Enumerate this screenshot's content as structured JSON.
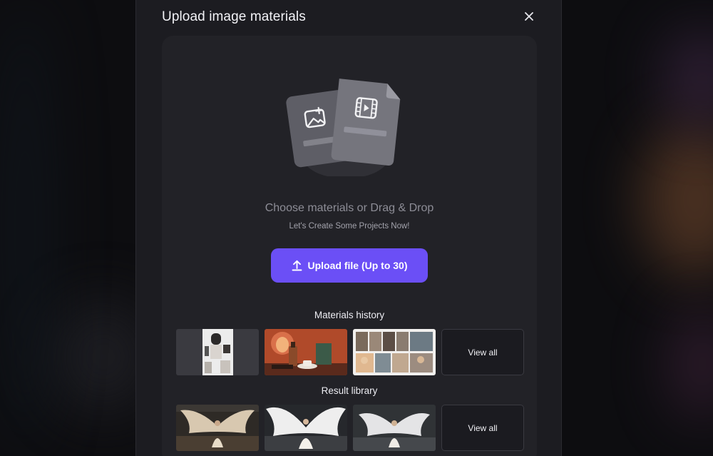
{
  "dialog": {
    "title": "Upload image materials",
    "close_icon": "close-icon"
  },
  "drop_zone": {
    "headline": "Choose materials or Drag & Drop",
    "subtext": "Let's Create Some Projects Now!",
    "upload_button_label": "Upload file (Up to 30)",
    "upload_icon": "upload-icon",
    "illustration_icons": [
      "image-file-icon",
      "video-file-icon"
    ]
  },
  "materials_history": {
    "label": "Materials history",
    "items": [
      "product-collage-thumbnail",
      "perfume-still-life-thumbnail",
      "portrait-grid-thumbnail"
    ],
    "view_all_label": "View all"
  },
  "result_library": {
    "label": "Result library",
    "items": [
      "angel-wings-result-1",
      "angel-wings-result-2",
      "angel-wings-result-3"
    ],
    "view_all_label": "View all"
  },
  "colors": {
    "accent": "#6b4ff6",
    "modal_bg": "#1c1c21",
    "panel_bg": "#222227"
  }
}
